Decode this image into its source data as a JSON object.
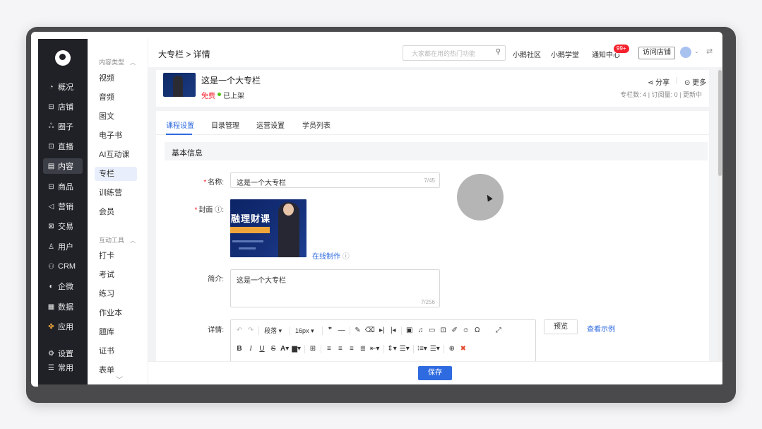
{
  "nav": {
    "items": [
      {
        "icon": "chart-pie-icon",
        "glyph": "◔",
        "label": "概况"
      },
      {
        "icon": "store-icon",
        "glyph": "⊟",
        "label": "店铺"
      },
      {
        "icon": "circle-group-icon",
        "glyph": "ஃ",
        "label": "圈子"
      },
      {
        "icon": "live-icon",
        "glyph": "⊡",
        "label": "直播"
      },
      {
        "icon": "content-icon",
        "glyph": "▤",
        "label": "内容",
        "active": true
      },
      {
        "icon": "goods-icon",
        "glyph": "⊟",
        "label": "商品"
      },
      {
        "icon": "marketing-icon",
        "glyph": "◁",
        "label": "营销"
      },
      {
        "icon": "trade-icon",
        "glyph": "⊠",
        "label": "交易"
      },
      {
        "icon": "user-icon",
        "glyph": "♙",
        "label": "用户"
      },
      {
        "icon": "crm-icon",
        "glyph": "⚇",
        "label": "CRM"
      },
      {
        "icon": "wecom-icon",
        "glyph": "◐",
        "label": "企微"
      },
      {
        "icon": "data-icon",
        "glyph": "▦",
        "label": "数据"
      },
      {
        "icon": "apps-icon",
        "glyph": "✤",
        "label": "应用"
      },
      {
        "icon": "settings-icon",
        "glyph": "⚙",
        "label": "设置"
      },
      {
        "icon": "common-icon",
        "glyph": "☰",
        "label": "常用"
      }
    ]
  },
  "subnav": {
    "group1": "内容类型",
    "group2": "互动工具",
    "items1": [
      "视频",
      "音频",
      "图文",
      "电子书",
      "AI互动课",
      "专栏",
      "训练营",
      "会员"
    ],
    "items2": [
      "打卡",
      "考试",
      "练习",
      "作业本",
      "题库",
      "证书",
      "表单"
    ]
  },
  "header": {
    "breadcrumb": "大专栏 > 详情",
    "search_placeholder": "大家都在用的热门功能",
    "links": [
      "小鹅社区",
      "小鹅学堂",
      "通知中心"
    ],
    "badge": "99+",
    "visit_store": "访问店铺"
  },
  "course": {
    "title": "这是一个大专栏",
    "price": "免费",
    "status": "已上架",
    "share": "分享",
    "more": "更多",
    "stats": "专栏数: 4 | 订阅量: 0 | 更新中"
  },
  "tabs": [
    "课程设置",
    "目录管理",
    "运营设置",
    "学员列表"
  ],
  "form": {
    "section": "基本信息",
    "name_label": "名称:",
    "name_value": "这是一个大专栏",
    "name_count": "7/45",
    "cover_label": "封面",
    "cover_text": "融理财课",
    "online_make": "在线制作",
    "intro_label": "简介:",
    "intro_value": "这是一个大专栏",
    "intro_count": "7/256",
    "detail_label": "详情:",
    "para_select": "段落",
    "size_select": "16px",
    "preview": "预览",
    "view_example": "查看示例",
    "save": "保存"
  }
}
